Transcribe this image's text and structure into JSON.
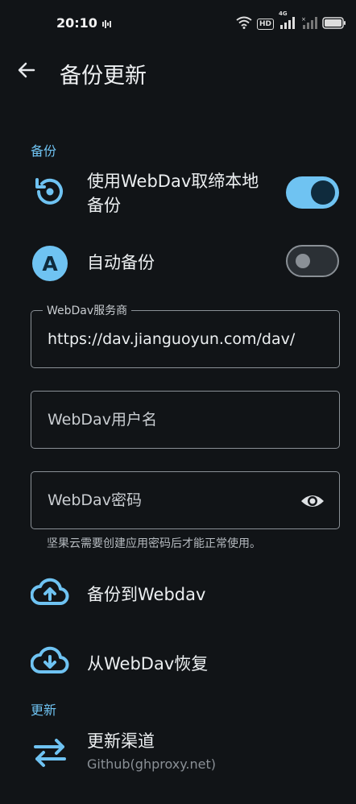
{
  "status": {
    "time": "20:10",
    "hd_badge": "HD",
    "net_label": "4G"
  },
  "header": {
    "title": "备份更新"
  },
  "backup_section": {
    "label": "备份",
    "webdav_toggle": {
      "label_line1": "使用WebDav取缔本地",
      "label_line2": "备份",
      "on": true
    },
    "auto_backup": {
      "icon_letter": "A",
      "label": "自动备份",
      "on": false
    }
  },
  "fields": {
    "server": {
      "legend": "WebDav服务商",
      "value": "https://dav.jianguoyun.com/dav/"
    },
    "username": {
      "placeholder": "WebDav用户名",
      "value": ""
    },
    "password": {
      "placeholder": "WebDav密码",
      "value": ""
    },
    "helper": "坚果云需要创建应用密码后才能正常使用。"
  },
  "actions": {
    "backup_to": "备份到Webdav",
    "restore_from": "从WebDav恢复"
  },
  "update_section": {
    "label": "更新",
    "channel": {
      "title": "更新渠道",
      "value": "Github(ghproxy.net)"
    }
  },
  "colors": {
    "accent": "#6fc3f2",
    "background": "#111417"
  },
  "icons": [
    "back-arrow-icon",
    "restore-icon",
    "auto-icon",
    "eye-icon",
    "cloud-upload-icon",
    "cloud-download-icon",
    "swap-icon"
  ]
}
